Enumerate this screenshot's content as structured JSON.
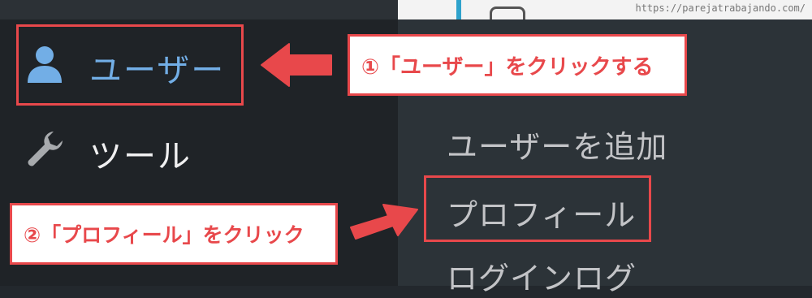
{
  "site_url": "https://parejatrabajando.com/",
  "sidebar": {
    "items": [
      {
        "label": "ユーザー",
        "icon": "user-icon",
        "active": true
      },
      {
        "label": "ツール",
        "icon": "wrench-icon",
        "active": false
      }
    ]
  },
  "submenu": {
    "items": [
      {
        "label": "ユーザーを追加"
      },
      {
        "label": "プロフィール"
      },
      {
        "label": "ログインログ"
      }
    ]
  },
  "annotations": {
    "step1": "①「ユーザー」をクリックする",
    "step2": "②「プロフィール」をクリック"
  },
  "colors": {
    "highlight": "#e8484b",
    "active_menu": "#72aee6",
    "sidebar_bg": "#1f2327",
    "submenu_bg": "#2c3338"
  }
}
